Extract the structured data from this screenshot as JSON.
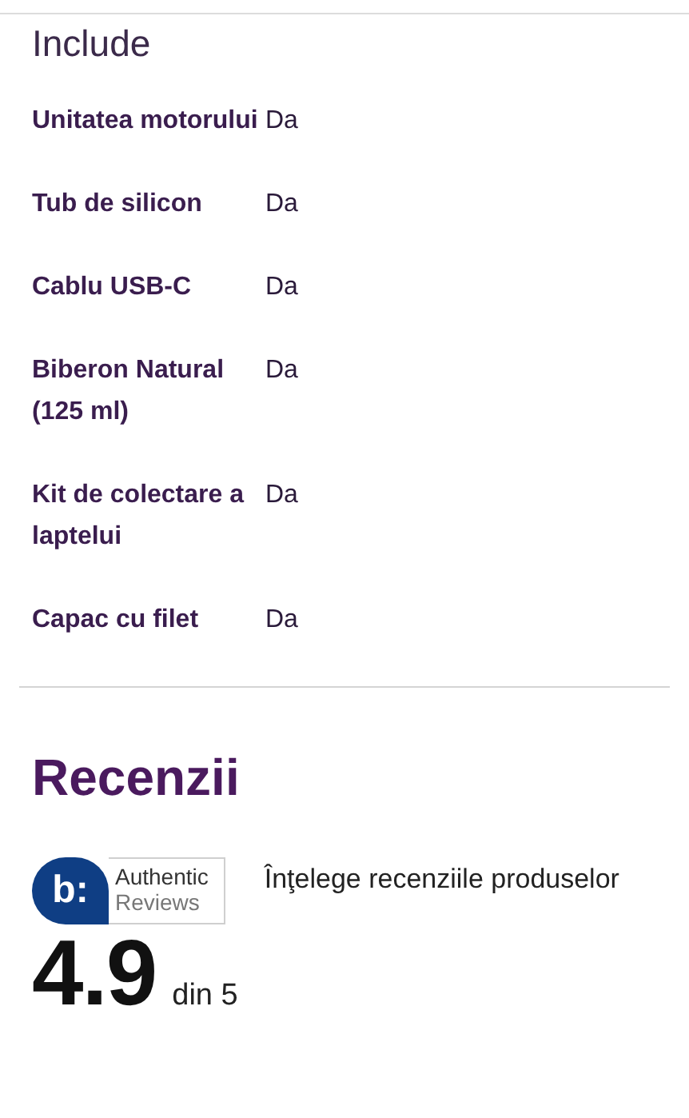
{
  "section_title": "Include",
  "specs": [
    {
      "label": "Unitatea motorului",
      "value": "Da"
    },
    {
      "label": "Tub de silicon",
      "value": "Da"
    },
    {
      "label": "Cablu USB-C",
      "value": "Da"
    },
    {
      "label": "Biberon Natural (125 ml)",
      "value": "Da"
    },
    {
      "label": "Kit de colectare a laptelui",
      "value": "Da"
    },
    {
      "label": "Capac cu filet",
      "value": "Da"
    }
  ],
  "reviews": {
    "title": "Recenzii",
    "badge": {
      "mark": "b:",
      "line1": "Authentic",
      "line2": "Reviews"
    },
    "link": "Înţelege recenziile produselor",
    "rating": "4.9",
    "scale": "din 5"
  }
}
